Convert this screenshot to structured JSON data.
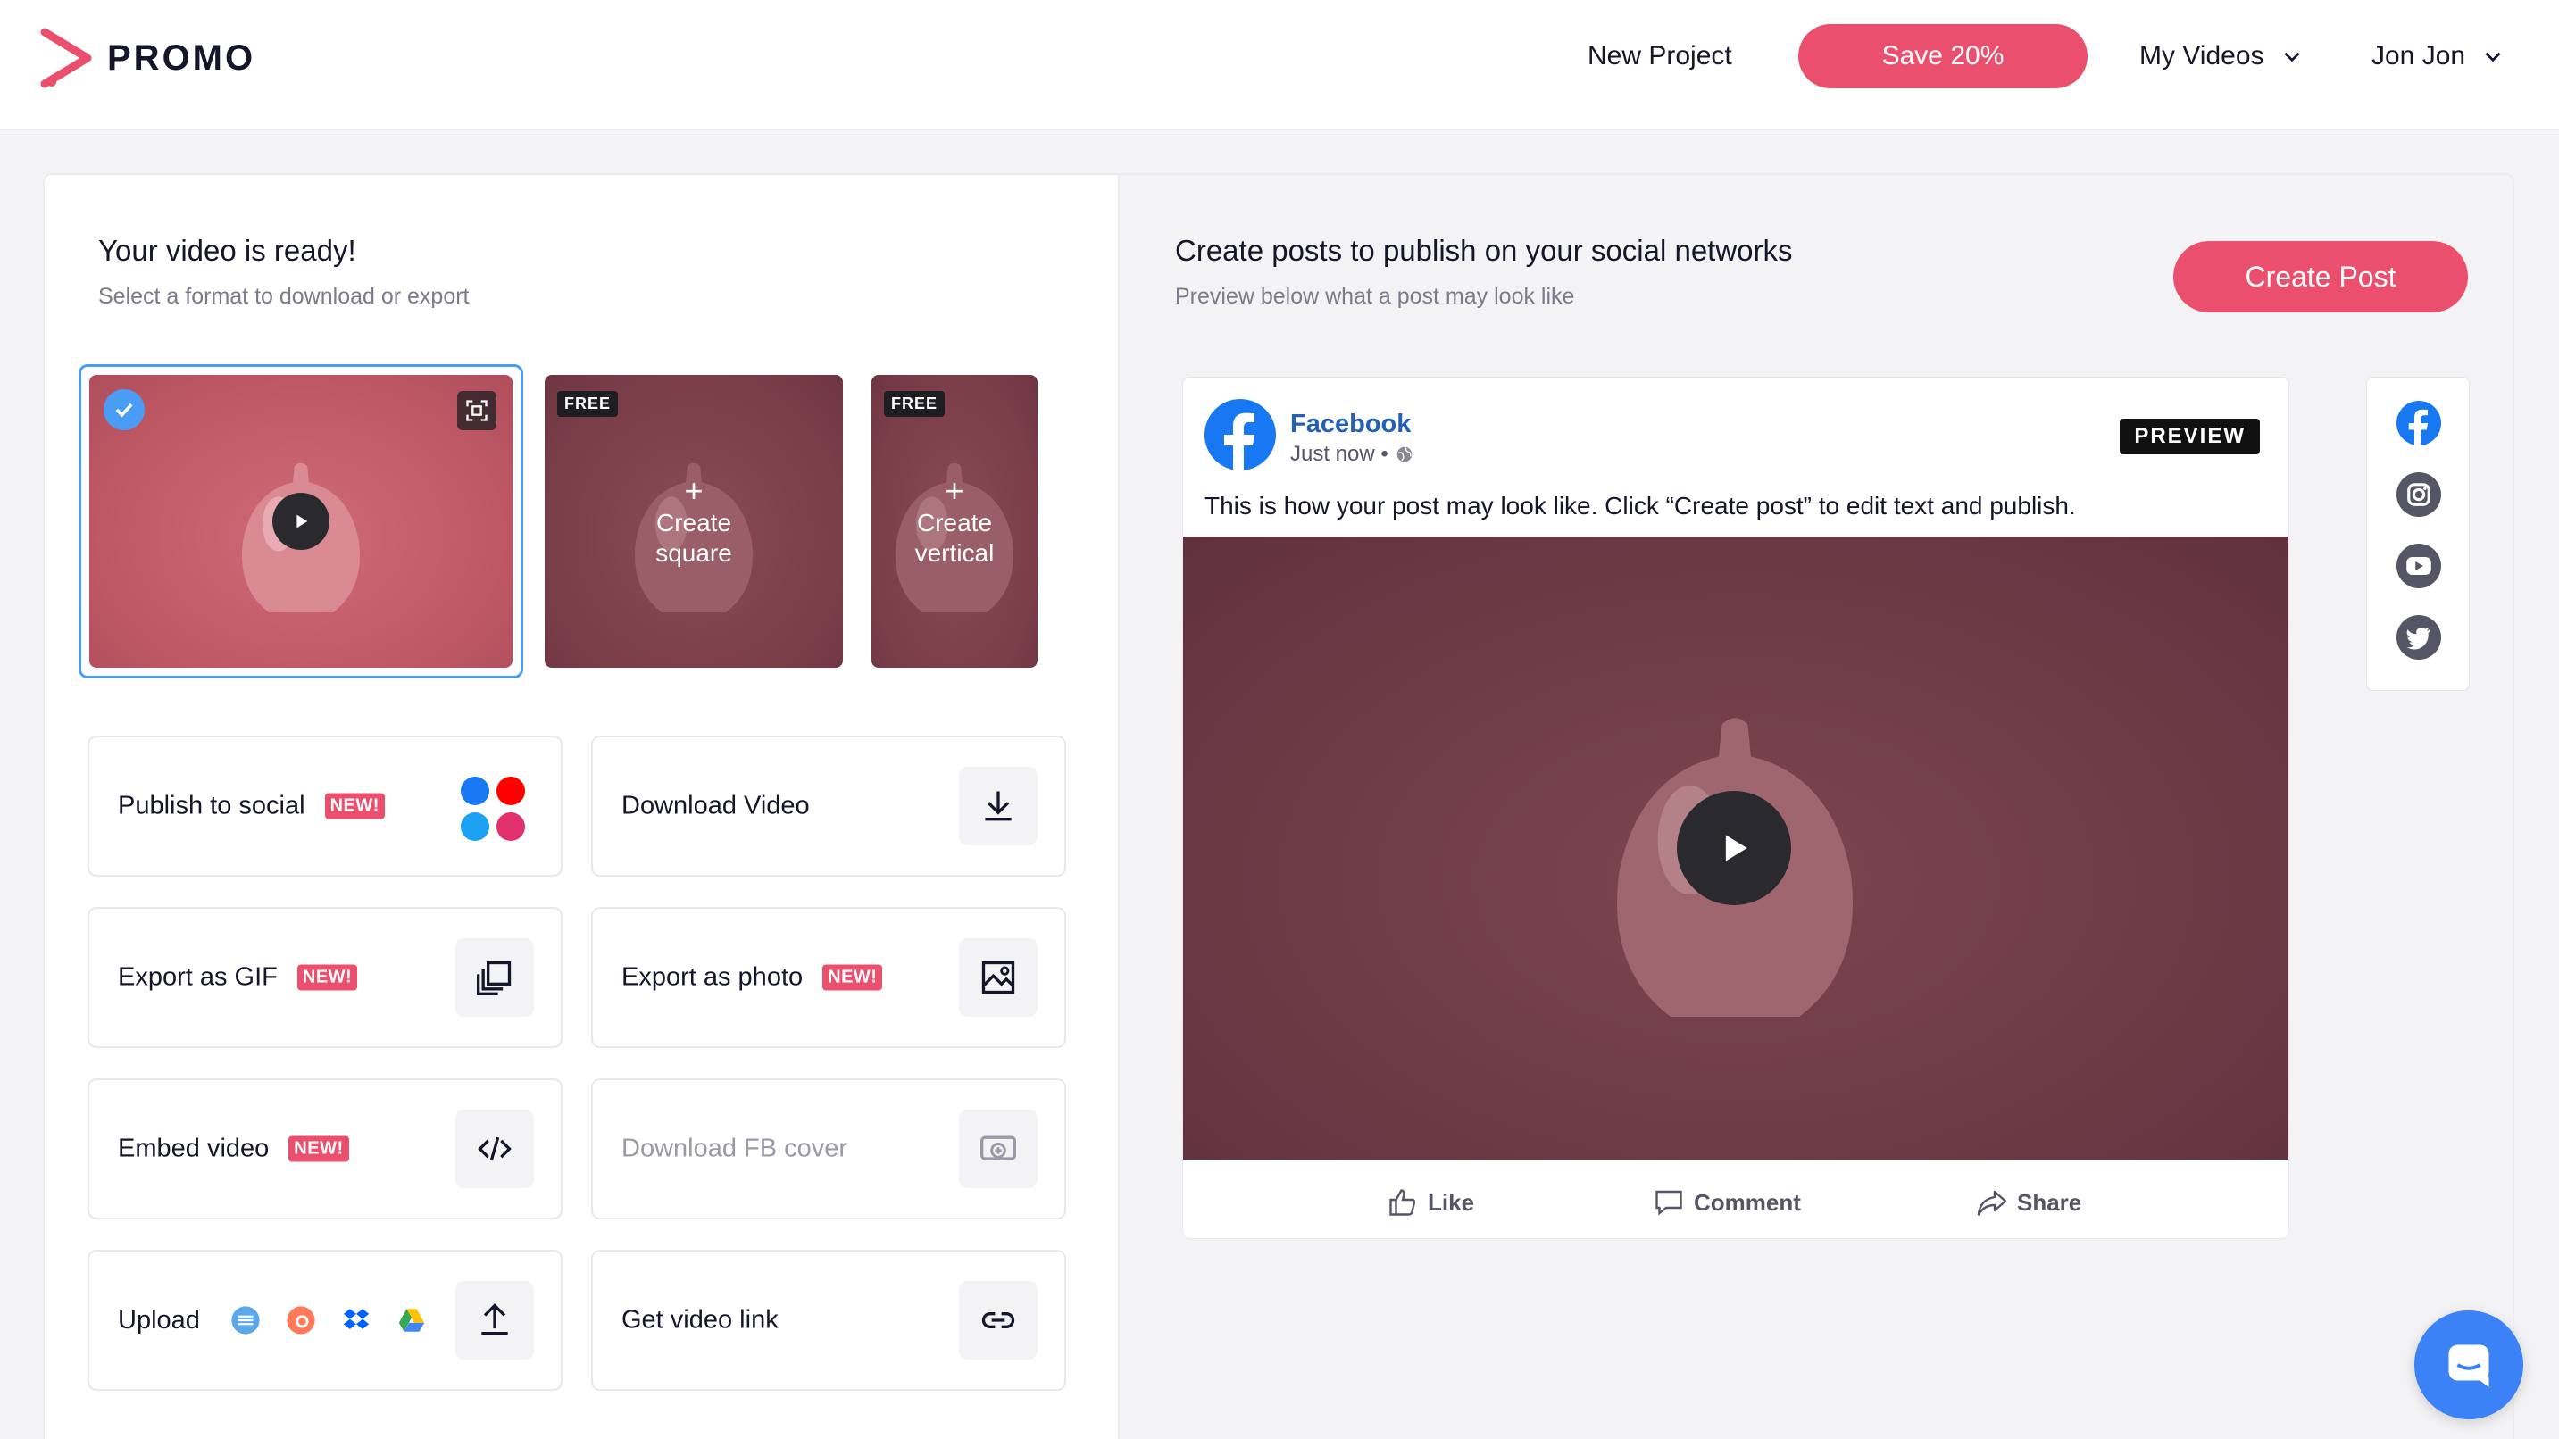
{
  "header": {
    "logo_text": "PROMO",
    "nav": {
      "new_project": "New Project",
      "save_label": "Save 20%",
      "my_videos": "My Videos",
      "user": "Jon Jon"
    }
  },
  "left": {
    "title": "Your video is ready!",
    "subtitle": "Select a format to download or export",
    "thumbnails": {
      "free_badge": "FREE",
      "create_square_plus": "+",
      "create_square": "Create square",
      "create_vertical_plus": "+",
      "create_vertical": "Create vertical"
    },
    "options": {
      "publish_social": "Publish to social",
      "download_video": "Download Video",
      "export_gif": "Export as GIF",
      "export_photo": "Export as photo",
      "embed_video": "Embed video",
      "download_fb_cover": "Download FB cover",
      "upload": "Upload",
      "get_video_link": "Get video link",
      "new_badge": "NEW!"
    }
  },
  "right": {
    "title": "Create posts to publish on your social networks",
    "subtitle": "Preview below what a post may look like",
    "create_post": "Create Post",
    "post": {
      "network": "Facebook",
      "time": "Just now •",
      "preview_badge": "PREVIEW",
      "text": "This is how your post may look like. Click “Create post” to edit text and publish.",
      "like": "Like",
      "comment": "Comment",
      "share": "Share"
    }
  },
  "colors": {
    "accent": "#ea4f6d",
    "selection": "#4a9df5",
    "facebook": "#1877f2"
  }
}
